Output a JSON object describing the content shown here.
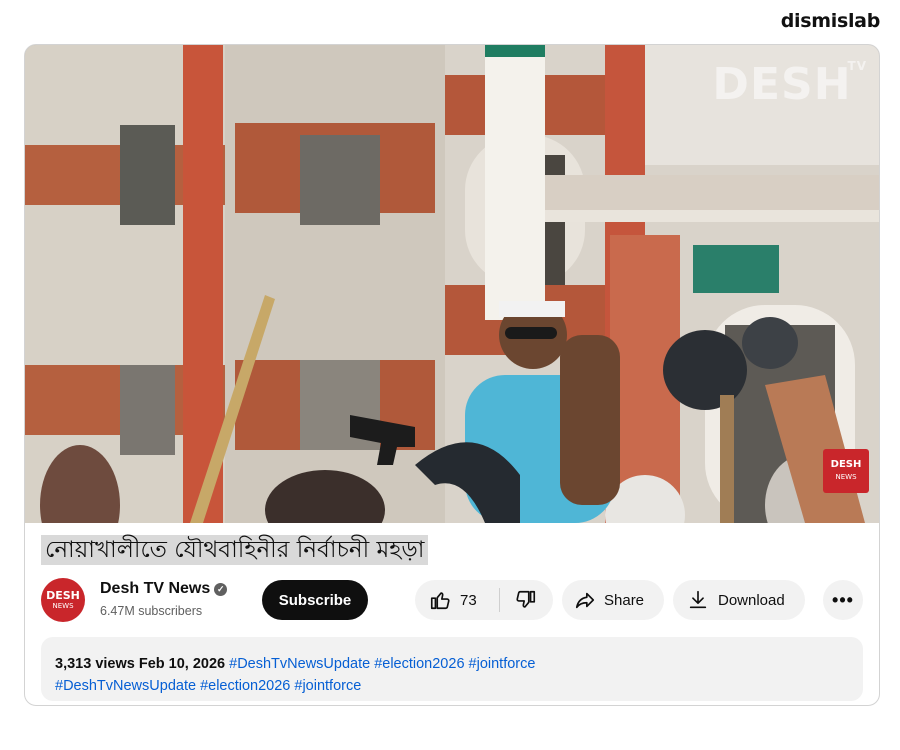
{
  "brand": {
    "logo_text": "dismislab"
  },
  "video": {
    "watermark": "DESH",
    "watermark_tv": "TV",
    "corner_badge": "DESH",
    "corner_badge_sub": "NEWS"
  },
  "title": "নোয়াখালীতে যৌথবাহিনীর নির্বাচনী মহড়া",
  "channel": {
    "avatar_text": "DESH",
    "avatar_sub": "NEWS",
    "name": "Desh TV News",
    "verified_icon": "check-icon",
    "subscribers": "6.47M subscribers"
  },
  "actions": {
    "subscribe": "Subscribe",
    "like_count": "73",
    "share": "Share",
    "download": "Download",
    "more": "•••"
  },
  "description": {
    "views": "3,313 views",
    "date": "Feb 10, 2026",
    "tags_line1": "#DeshTvNewsUpdate #election2026 #jointforce",
    "tags_line2": "#DeshTvNewsUpdate #election2026 #jointforce"
  },
  "colors": {
    "accent_red": "#c9262b",
    "link_blue": "#065fd4",
    "pill_bg": "#f2f2f2"
  }
}
